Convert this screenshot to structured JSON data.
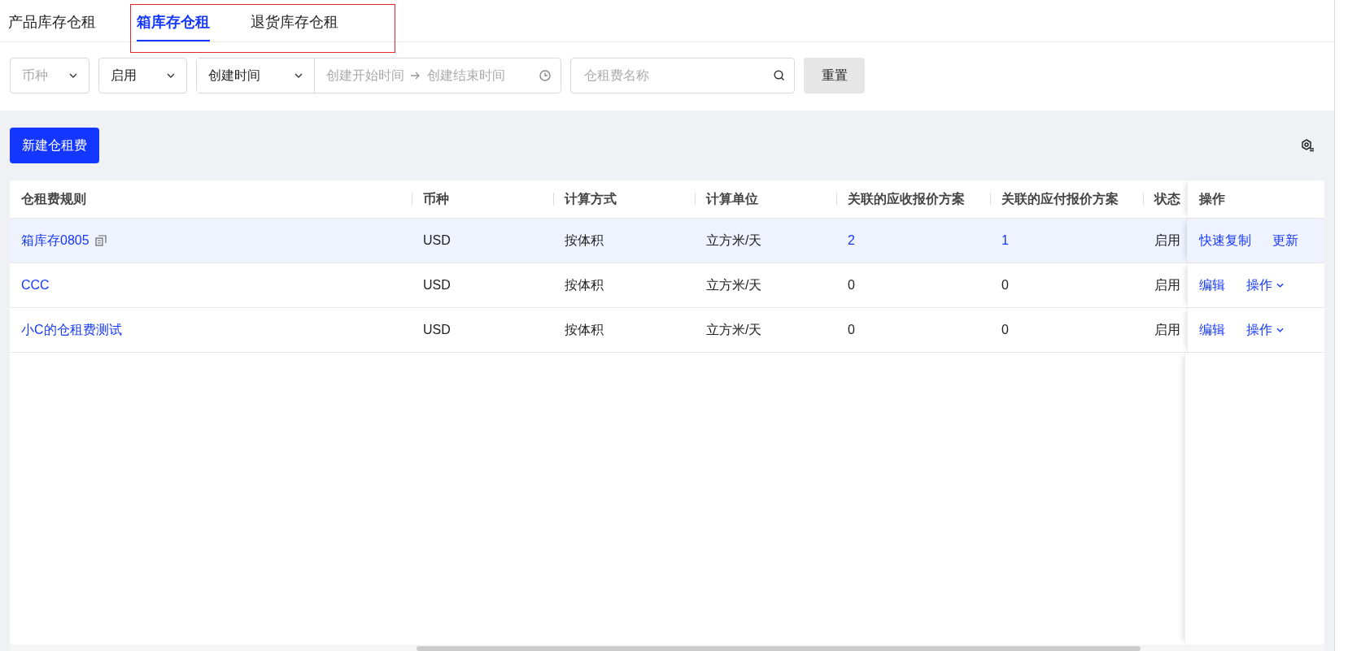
{
  "tabs": [
    {
      "label": "产品库存仓租",
      "selected": false
    },
    {
      "label": "箱库存仓租",
      "selected": true
    },
    {
      "label": "退货库存仓租",
      "selected": false
    }
  ],
  "filters": {
    "currency": {
      "placeholder": "币种"
    },
    "status": {
      "value": "启用"
    },
    "date_type": {
      "value": "创建时间"
    },
    "date_range": {
      "start_placeholder": "创建开始时间",
      "end_placeholder": "创建结束时间"
    },
    "search": {
      "placeholder": "仓租费名称"
    },
    "reset_button": "重置"
  },
  "new_button": "新建仓租费",
  "table": {
    "columns": [
      "仓租费规则",
      "币种",
      "计算方式",
      "计算单位",
      "关联的应收报价方案",
      "关联的应付报价方案",
      "状态",
      "操作"
    ],
    "rows": [
      {
        "highlighted": true,
        "rule": "箱库存0805",
        "show_copy": true,
        "currency": "USD",
        "method": "按体积",
        "unit": "立方米/天",
        "receivable": {
          "text": "2",
          "link": true
        },
        "payable": {
          "text": "1",
          "link": true
        },
        "status": "启用",
        "actions": [
          {
            "label": "快速复制",
            "dropdown": false
          },
          {
            "label": "更新",
            "dropdown": false
          }
        ]
      },
      {
        "highlighted": false,
        "rule": "CCC",
        "show_copy": false,
        "currency": "USD",
        "method": "按体积",
        "unit": "立方米/天",
        "receivable": {
          "text": "0",
          "link": false
        },
        "payable": {
          "text": "0",
          "link": false
        },
        "status": "启用",
        "actions": [
          {
            "label": "编辑",
            "dropdown": false
          },
          {
            "label": "操作",
            "dropdown": true
          }
        ]
      },
      {
        "highlighted": false,
        "rule": "小C的仓租费测试",
        "show_copy": false,
        "currency": "USD",
        "method": "按体积",
        "unit": "立方米/天",
        "receivable": {
          "text": "0",
          "link": false
        },
        "payable": {
          "text": "0",
          "link": false
        },
        "status": "启用",
        "actions": [
          {
            "label": "编辑",
            "dropdown": false
          },
          {
            "label": "操作",
            "dropdown": true
          }
        ]
      }
    ]
  }
}
